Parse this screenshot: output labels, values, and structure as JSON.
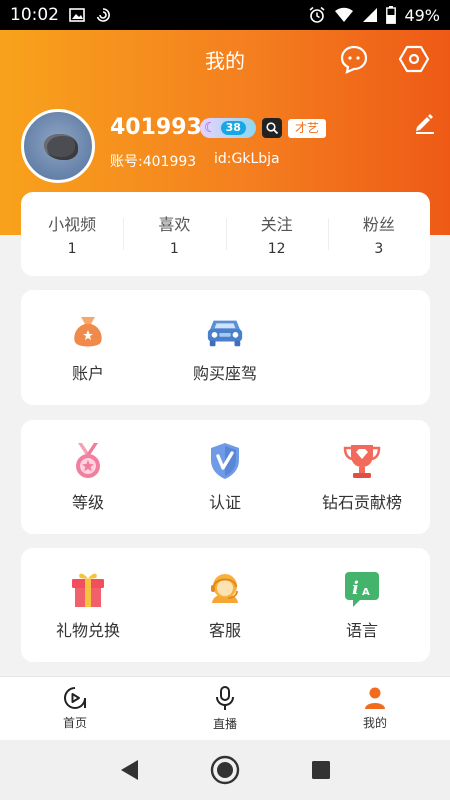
{
  "status_bar": {
    "time": "10:02",
    "battery": "49%"
  },
  "header": {
    "title": "我的"
  },
  "profile": {
    "username": "401993",
    "level_badge": "38",
    "talent_tag": "才艺",
    "account": "账号:401993",
    "id": "id:GkLbja"
  },
  "stats": [
    {
      "label": "小视频",
      "value": "1"
    },
    {
      "label": "喜欢",
      "value": "1"
    },
    {
      "label": "关注",
      "value": "12"
    },
    {
      "label": "粉丝",
      "value": "3"
    }
  ],
  "menu": {
    "account": "账户",
    "buy_car": "购买座驾",
    "level": "等级",
    "verify": "认证",
    "diamond_rank": "钻石贡献榜",
    "gift_exchange": "礼物兑换",
    "customer_service": "客服",
    "language": "语言"
  },
  "bottom_nav": {
    "home": "首页",
    "live": "直播",
    "mine": "我的"
  },
  "colors": {
    "accent": "#f47f1f",
    "header_start": "#f8a21c",
    "header_end": "#ee5a16"
  },
  "icons": [
    "wifi-icon",
    "signal-icon",
    "battery-icon",
    "alarm-icon",
    "chat-bubble-icon",
    "settings-hex-icon",
    "edit-pencil-icon",
    "money-bag-icon",
    "car-icon",
    "medal-icon",
    "shield-v-icon",
    "trophy-icon",
    "gift-icon",
    "headset-agent-icon",
    "language-icon",
    "home-play-icon",
    "microphone-icon",
    "person-icon"
  ]
}
